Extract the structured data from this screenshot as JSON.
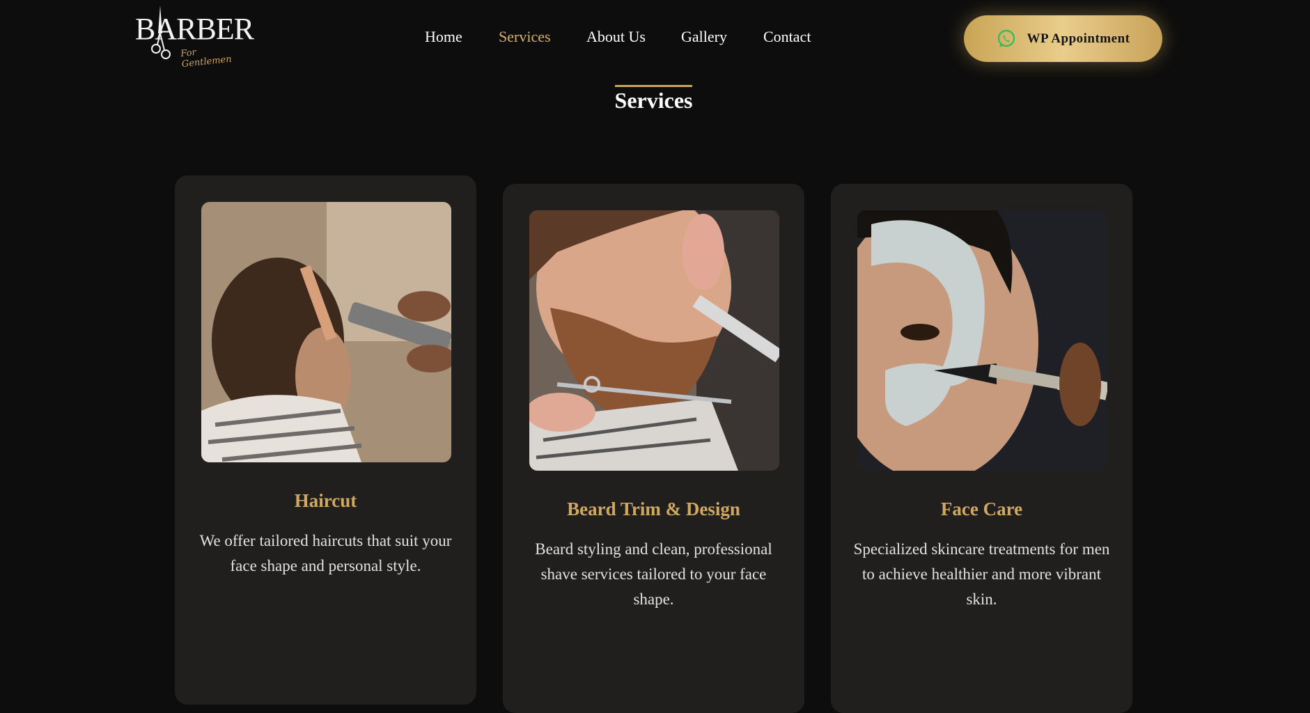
{
  "brand": {
    "logo_text": "BARBER",
    "logo_tagline": "For Gentlemen"
  },
  "nav": {
    "items": [
      {
        "label": "Home",
        "active": false
      },
      {
        "label": "Services",
        "active": true
      },
      {
        "label": "About Us",
        "active": false
      },
      {
        "label": "Gallery",
        "active": false
      },
      {
        "label": "Contact",
        "active": false
      }
    ]
  },
  "cta": {
    "label": "WP Appointment",
    "icon": "whatsapp-icon"
  },
  "section": {
    "title": "Services"
  },
  "services": [
    {
      "title": "Haircut",
      "description": "We offer tailored haircuts that suit your face shape and personal style.",
      "image": "haircut-photo"
    },
    {
      "title": "Beard Trim & Design",
      "description": "Beard styling and clean, professional shave services tailored to your face shape.",
      "image": "beard-trim-photo"
    },
    {
      "title": "Face Care",
      "description": "Specialized skincare treatments for men to achieve healthier and more vibrant skin.",
      "image": "face-care-photo"
    }
  ],
  "colors": {
    "background": "#0d0d0d",
    "card": "#211f1e",
    "accent_gold": "#d0a860",
    "whatsapp_green": "#3cba5a"
  }
}
